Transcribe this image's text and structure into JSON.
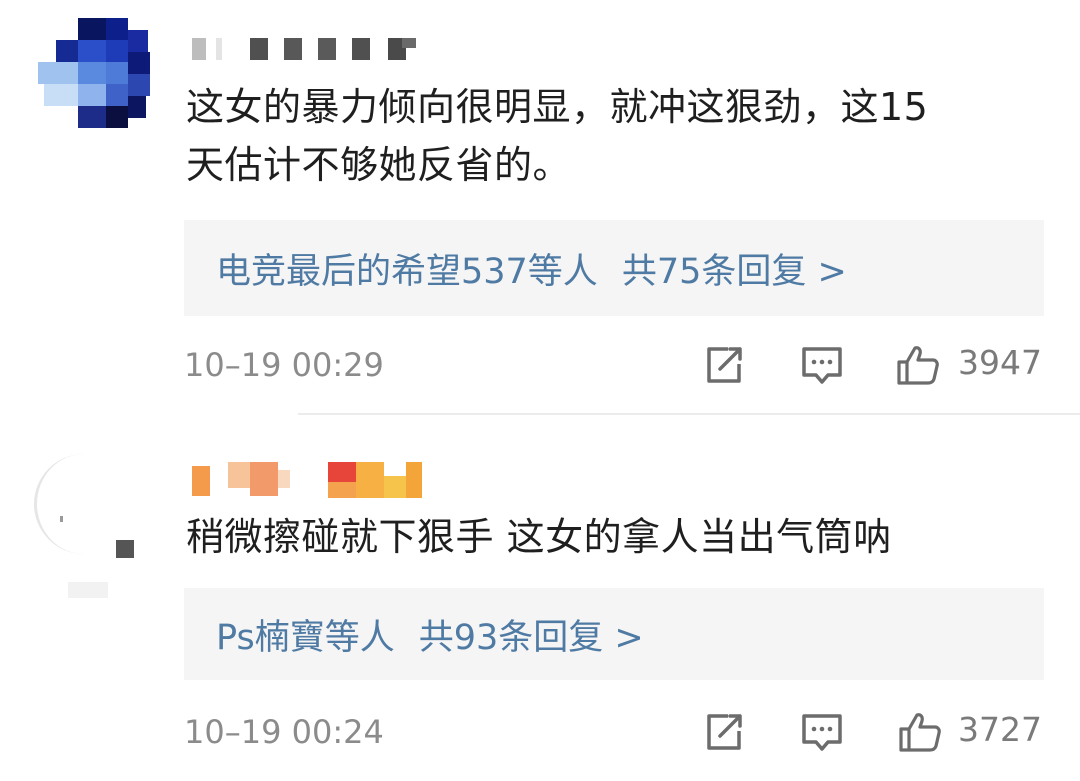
{
  "comments": [
    {
      "text_line1": "这女的暴力倾向很明显，就冲这狠劲，这15",
      "text_line2": "天估计不够她反省的。",
      "reply_users": "电竞最后的希望537等人",
      "reply_count": "共75条回复 >",
      "timestamp": "10–19 00:29",
      "likes": "3947"
    },
    {
      "text_line1": "稍微擦碰就下狠手 这女的拿人当出气筒呐",
      "reply_users": "Ps楠寶等人",
      "reply_count": "共93条回复 >",
      "timestamp": "10–19 00:24",
      "likes": "3727"
    }
  ],
  "icons": {
    "repost": "share-icon",
    "comment": "comment-icon",
    "like": "thumbs-up-icon"
  },
  "colors": {
    "reply_link": "#4f7aa3",
    "meta_text": "#8b8b8b",
    "reply_bg": "#f5f5f5"
  }
}
